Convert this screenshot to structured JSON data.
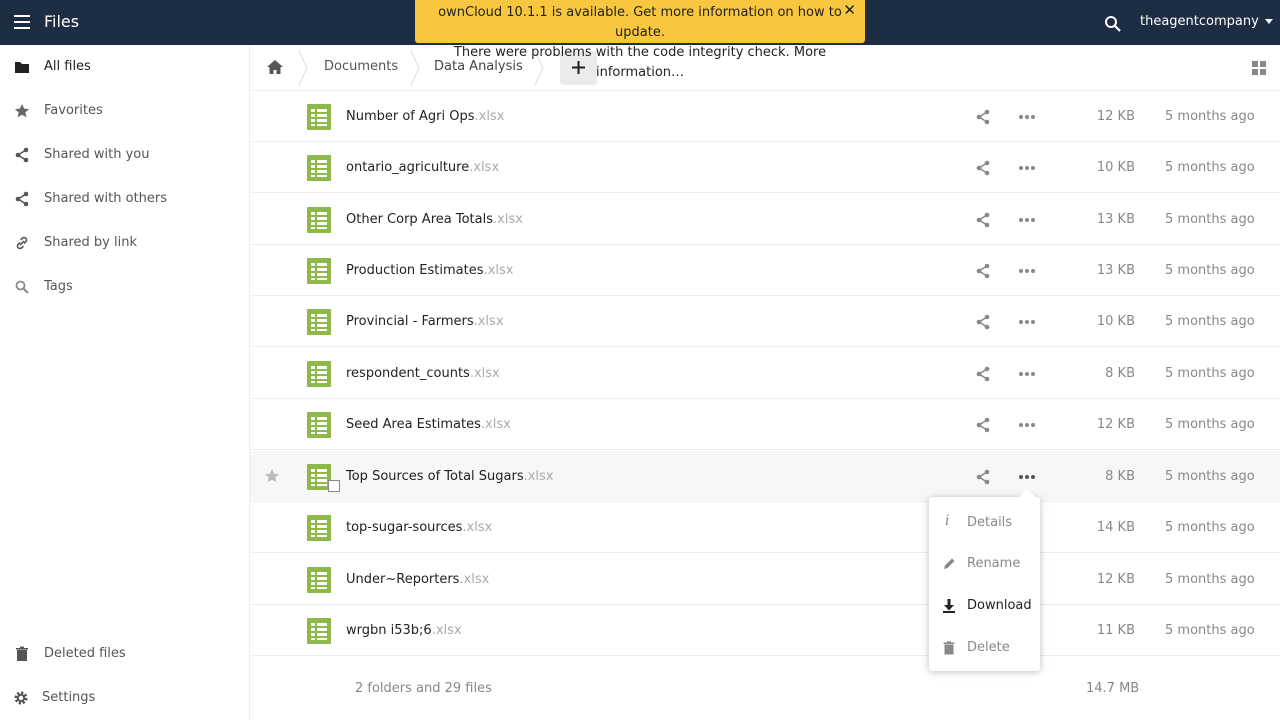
{
  "header": {
    "app_title": "Files",
    "user_name": "theagentcompany"
  },
  "notification": {
    "line1": "ownCloud 10.1.1 is available. Get more information on how to update.",
    "line2": "There were problems with the code integrity check. More information…",
    "close_glyph": "✕"
  },
  "sidebar": {
    "items": [
      {
        "label": "All files",
        "icon": "folder-icon"
      },
      {
        "label": "Favorites",
        "icon": "star-icon"
      },
      {
        "label": "Shared with you",
        "icon": "share-icon"
      },
      {
        "label": "Shared with others",
        "icon": "share-icon"
      },
      {
        "label": "Shared by link",
        "icon": "link-icon"
      },
      {
        "label": "Tags",
        "icon": "tag-search-icon"
      }
    ],
    "bottom": [
      {
        "label": "Deleted files",
        "icon": "trash-icon"
      },
      {
        "label": "Settings",
        "icon": "gear-icon"
      }
    ]
  },
  "breadcrumb": {
    "items": [
      "Documents",
      "Data Analysis"
    ],
    "new_label": "+"
  },
  "files": [
    {
      "name": "Number of Agri Ops",
      "ext": ".xlsx",
      "size": "12 KB",
      "modified": "5 months ago"
    },
    {
      "name": "ontario_agriculture",
      "ext": ".xlsx",
      "size": "10 KB",
      "modified": "5 months ago"
    },
    {
      "name": "Other Corp Area Totals",
      "ext": ".xlsx",
      "size": "13 KB",
      "modified": "5 months ago"
    },
    {
      "name": "Production Estimates",
      "ext": ".xlsx",
      "size": "13 KB",
      "modified": "5 months ago"
    },
    {
      "name": "Provincial - Farmers",
      "ext": ".xlsx",
      "size": "10 KB",
      "modified": "5 months ago"
    },
    {
      "name": "respondent_counts",
      "ext": ".xlsx",
      "size": "8 KB",
      "modified": "5 months ago"
    },
    {
      "name": "Seed Area Estimates",
      "ext": ".xlsx",
      "size": "12 KB",
      "modified": "5 months ago"
    },
    {
      "name": "Top Sources of Total Sugars",
      "ext": ".xlsx",
      "size": "8 KB",
      "modified": "5 months ago"
    },
    {
      "name": "top-sugar-sources",
      "ext": ".xlsx",
      "size": "14 KB",
      "modified": "5 months ago"
    },
    {
      "name": "Under~Reporters",
      "ext": ".xlsx",
      "size": "12 KB",
      "modified": "5 months ago"
    },
    {
      "name": "wrgbn i53b;6",
      "ext": ".xlsx",
      "size": "11 KB",
      "modified": "5 months ago"
    }
  ],
  "summary": {
    "counts": "2 folders and 29 files",
    "total_size": "14.7 MB"
  },
  "file_menu": {
    "items": [
      "Details",
      "Rename",
      "Download",
      "Delete"
    ]
  },
  "colors": {
    "header_bg": "#1d2d44",
    "notification_bg": "#f8c63f",
    "spreadsheet_icon": "#8fb84a"
  }
}
